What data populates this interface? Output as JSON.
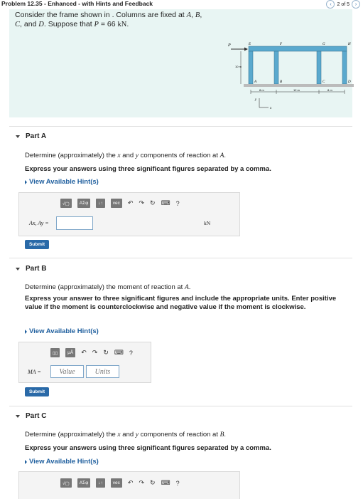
{
  "header": {
    "problem_title": "Problem 12.35 - Enhanced - with Hints and Feedback",
    "pagination": "2 of 5",
    "prev_symbol": "‹",
    "next_symbol": "›"
  },
  "intro": {
    "text_start": "Consider the frame shown in . Columns are fixed at ",
    "text_a": "A",
    "text_comma1": ", ",
    "text_b": "B",
    "text_comma2": ",",
    "text_c": "C",
    "text_and": ", and ",
    "text_d": "D",
    "text_suppose": ". Suppose that ",
    "text_p": "P",
    "text_value": " = 66 ",
    "text_unit": "kN",
    "text_end": "."
  },
  "figure": {
    "labels": {
      "P": "P",
      "E": "E",
      "F": "F",
      "G": "G",
      "H": "H",
      "A": "A",
      "B": "B",
      "C": "C",
      "D": "D",
      "x": "x",
      "y": "y"
    },
    "dims": {
      "height": "10 m",
      "left": "8 m",
      "middle": "12 m",
      "right": "8 m"
    }
  },
  "partA": {
    "title": "Part A",
    "question_pre": "Determine (approximately) the ",
    "question_x": "x",
    "question_and": " and ",
    "question_y": "y",
    "question_post": " components of reaction at ",
    "question_at": "A",
    "question_end": ".",
    "instruction": "Express your answers using three significant figures separated by a comma.",
    "hint": "View Available Hint(s)",
    "toolbar": [
      "√▢",
      "ΑΣφ",
      "↓↑",
      "vec"
    ],
    "label": "Ax, Ay =",
    "unit": "kN",
    "submit": "Submit"
  },
  "partB": {
    "title": "Part B",
    "question_pre": "Determine (approximately) the moment of reaction at ",
    "question_at": "A",
    "question_end": ".",
    "instruction": "Express your answer to three significant figures and include the appropriate units. Enter positive value if the moment is counterclockwise and negative value if the moment is clockwise.",
    "hint": "View Available Hint(s)",
    "toolbar": [
      "▯▯",
      "μÅ"
    ],
    "label": "MA =",
    "value_placeholder": "Value",
    "units_placeholder": "Units",
    "submit": "Submit"
  },
  "partC": {
    "title": "Part C",
    "question_pre": "Determine (approximately) the ",
    "question_x": "x",
    "question_and": " and ",
    "question_y": "y",
    "question_post": " components of reaction at ",
    "question_at": "B",
    "question_end": ".",
    "instruction": "Express your answers using three significant figures separated by a comma.",
    "hint": "View Available Hint(s)",
    "toolbar": [
      "√▢",
      "ΑΣφ",
      "↓↑",
      "vec"
    ]
  }
}
